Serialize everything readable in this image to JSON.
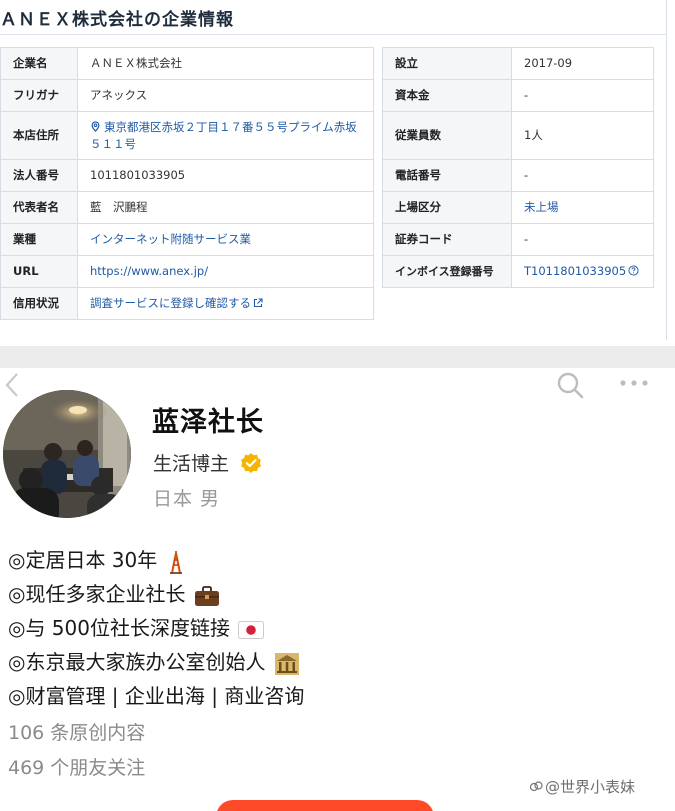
{
  "company": {
    "title": "ＡＮＥＸ株式会社の企業情報",
    "left_rows": [
      {
        "label": "企業名",
        "value": "ＡＮＥＸ株式会社",
        "type": "text"
      },
      {
        "label": "フリガナ",
        "value": "アネックス",
        "type": "text"
      },
      {
        "label": "本店住所",
        "value": "東京都港区赤坂２丁目１７番５５号プライム赤坂５１１号",
        "type": "address"
      },
      {
        "label": "法人番号",
        "value": "1011801033905",
        "type": "text"
      },
      {
        "label": "代表者名",
        "value": "藍　沢鵬程",
        "type": "text"
      },
      {
        "label": "業種",
        "value": "インターネット附随サービス業",
        "type": "link"
      },
      {
        "label": "URL",
        "value": "https://www.anex.jp/",
        "type": "link"
      },
      {
        "label": "信用状況",
        "value": "調査サービスに登録し確認する",
        "type": "external-link"
      }
    ],
    "right_rows": [
      {
        "label": "設立",
        "value": "2017-09",
        "type": "text"
      },
      {
        "label": "資本金",
        "value": "-",
        "type": "text"
      },
      {
        "label": "従業員数",
        "value": "1人",
        "type": "text"
      },
      {
        "label": "電話番号",
        "value": "-",
        "type": "text"
      },
      {
        "label": "上場区分",
        "value": "未上場",
        "type": "link"
      },
      {
        "label": "証券コード",
        "value": "-",
        "type": "text"
      },
      {
        "label": "インボイス登録番号",
        "value": "T1011801033905",
        "type": "help-link"
      }
    ],
    "colors": {
      "link": "#1f5aa6",
      "label_bg": "#f4f6f8",
      "border": "#d6dde5"
    }
  },
  "profile": {
    "nickname": "蓝泽社长",
    "role": "生活博主",
    "location": "日本 男",
    "bio": [
      {
        "text": "◎定居日本 30年",
        "emoji": "tokyo-tower-icon"
      },
      {
        "text": "◎现任多家企业社长",
        "emoji": "briefcase-icon"
      },
      {
        "text": "◎与 500位社长深度链接",
        "emoji": "japan-flag-icon"
      },
      {
        "text": "◎东京最大家族办公室创始人",
        "emoji": "bank-icon"
      },
      {
        "text": "◎财富管理 | 企业出海 | 商业咨询",
        "emoji": ""
      }
    ],
    "stats": {
      "posts": "106 条原创内容",
      "friends": "469 个朋友关注"
    },
    "colors": {
      "badge": "#f5b400",
      "button": "#ff4a28"
    }
  },
  "watermark": {
    "text": "@世界小表妹"
  }
}
